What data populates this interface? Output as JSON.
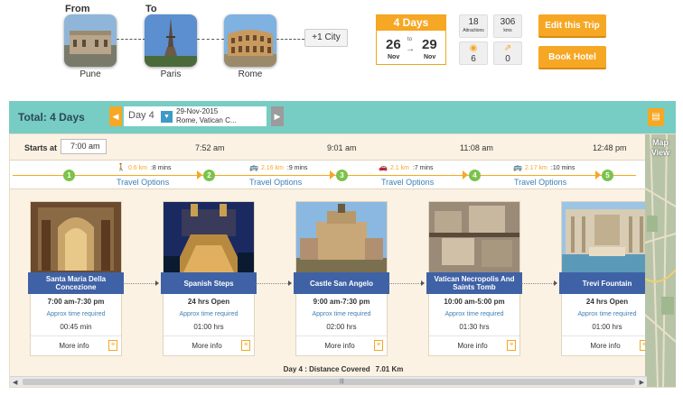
{
  "header": {
    "from_label": "From",
    "to_label": "To",
    "cities": [
      {
        "name": "Pune"
      },
      {
        "name": "Paris"
      },
      {
        "name": "Rome"
      }
    ],
    "add_city_label": "+1 City"
  },
  "trip": {
    "days_label": "4 Days",
    "start_day": "26",
    "start_month": "Nov",
    "end_day": "29",
    "end_month": "Nov",
    "to_word": "to",
    "attractions_count": "18",
    "attractions_label": "Attractions",
    "km_count": "306",
    "km_label": "kms",
    "views_count": "6",
    "shares_count": "0",
    "edit_label": "Edit this Trip",
    "book_label": "Book Hotel"
  },
  "toolbar": {
    "total_label": "Total: 4 Days",
    "day_label": "Day 4",
    "day_date": "29-Nov-2015",
    "day_city": "Rome, Vatican C..."
  },
  "timeline": {
    "starts_label": "Starts at",
    "starts_value": "7:00 am",
    "time_marks": [
      "7:52 am",
      "9:01 am",
      "11:08 am",
      "12:48 pm"
    ],
    "stops": [
      "1",
      "2",
      "3",
      "4",
      "5"
    ],
    "transits": [
      {
        "icon": "walk-icon",
        "glyph": "🚶",
        "km": "0.6 km",
        "mins": ":8 mins",
        "options": "Travel Options"
      },
      {
        "icon": "bus-icon",
        "glyph": "🚌",
        "km": "2.16 km",
        "mins": ":9 mins",
        "options": "Travel Options"
      },
      {
        "icon": "car-icon",
        "glyph": "🚗",
        "km": "2.1 km",
        "mins": ":7 mins",
        "options": "Travel Options"
      },
      {
        "icon": "bus-icon",
        "glyph": "🚌",
        "km": "2.17 km",
        "mins": ":10 mins",
        "options": "Travel Options"
      }
    ],
    "map_view_label": "Map View",
    "attractions": [
      {
        "title": "Santa Maria Della Concezione",
        "hours": "7:00 am-7:30 pm",
        "approx": "Approx time required",
        "duration": "00:45 min",
        "more": "More info"
      },
      {
        "title": "Spanish Steps",
        "hours": "24 hrs Open",
        "approx": "Approx time required",
        "duration": "01:00 hrs",
        "more": "More info"
      },
      {
        "title": "Castle San Angelo",
        "hours": "9:00 am-7:30 pm",
        "approx": "Approx time required",
        "duration": "02:00 hrs",
        "more": "More info"
      },
      {
        "title": "Vatican Necropolis And Saints Tomb",
        "hours": "10:00 am-5:00 pm",
        "approx": "Approx time required",
        "duration": "01:30 hrs",
        "more": "More info"
      },
      {
        "title": "Trevi Fountain",
        "hours": "24 hrs Open",
        "approx": "Approx time required",
        "duration": "01:00 hrs",
        "more": "More info"
      }
    ],
    "distance_label": "Day 4 : Distance Covered",
    "distance_value": "7.01 Km"
  },
  "colors": {
    "accent": "#f6a724",
    "teal": "#77ccc4",
    "title_blue": "#3f62a6",
    "link_blue": "#3e7fb5",
    "stop_green": "#7cc24b"
  }
}
